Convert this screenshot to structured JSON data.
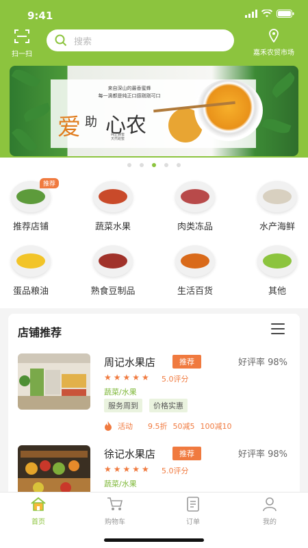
{
  "status_bar": {
    "time": "9:41"
  },
  "header": {
    "scan_label": "扫一扫",
    "search_placeholder": "搜索",
    "location_label": "嘉禾农贸市场"
  },
  "banner": {
    "description_line1": "来自深山的最香蜜蜂",
    "description_line2": "每一滴都是纯正口感刚刚可口",
    "title_char1": "爱",
    "title_char2": "助",
    "title_char3": "心农",
    "small_line1": "纯正蜂蜜",
    "small_line2": "天然甜蜜",
    "slide_count": 5,
    "active_slide": 3
  },
  "categories": [
    {
      "label": "推荐店铺",
      "badge": "推荐",
      "icon": "vegetables-icon",
      "color": "#5d9b3b"
    },
    {
      "label": "蔬菜水果",
      "icon": "fruit-veg-icon",
      "color": "#c94a2a"
    },
    {
      "label": "肉类冻品",
      "icon": "meat-icon",
      "color": "#b84a4a"
    },
    {
      "label": "水产海鲜",
      "icon": "fish-icon",
      "color": "#d8d0c0"
    },
    {
      "label": "蛋品粮油",
      "icon": "oil-icon",
      "color": "#f2c428"
    },
    {
      "label": "熟食豆制品",
      "icon": "beans-icon",
      "color": "#a0322a"
    },
    {
      "label": "生活百货",
      "icon": "spices-icon",
      "color": "#d96a1a"
    },
    {
      "label": "其他",
      "icon": "clover-icon",
      "color": "#8cc43e"
    }
  ],
  "recommend": {
    "title": "店铺推荐",
    "shops": [
      {
        "name": "周记水果店",
        "badge": "推荐",
        "rating": "好评率 98%",
        "stars": "★★★★★",
        "score": "5.0评分",
        "category": "蔬菜/水果",
        "tags": [
          "服务周到",
          "价格实惠"
        ],
        "activity": "活动",
        "promos": [
          "9.5折",
          "50减5",
          "100减10"
        ]
      },
      {
        "name": "徐记水果店",
        "badge": "推荐",
        "rating": "好评率 98%",
        "stars": "★★★★★",
        "score": "5.0评分",
        "category": "蔬菜/水果",
        "tags": [],
        "activity": "",
        "promos": []
      }
    ]
  },
  "tabbar": [
    {
      "label": "首页",
      "icon": "home-icon",
      "active": true
    },
    {
      "label": "购物车",
      "icon": "cart-icon",
      "active": false
    },
    {
      "label": "订单",
      "icon": "order-icon",
      "active": false
    },
    {
      "label": "我的",
      "icon": "user-icon",
      "active": false
    }
  ],
  "colors": {
    "brand": "#8cc43e",
    "accent": "#f07a3f"
  }
}
